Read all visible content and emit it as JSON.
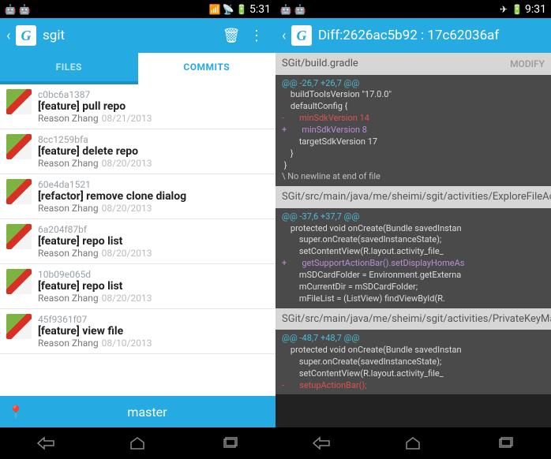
{
  "left": {
    "status": {
      "time": "5:31"
    },
    "actionbar": {
      "title": "sgit"
    },
    "tabs": {
      "files": "FILES",
      "commits": "COMMITS"
    },
    "commits": [
      {
        "hash": "c0bc6a1387",
        "msg": "[feature] pull repo",
        "author": "Reason Zhang",
        "date": "08/21/2013"
      },
      {
        "hash": "8cc1259bfa",
        "msg": "[feature] delete repo",
        "author": "Reason Zhang",
        "date": "08/20/2013"
      },
      {
        "hash": "60e4da1521",
        "msg": "[refactor] remove clone dialog",
        "author": "Reason Zhang",
        "date": "08/20/2013"
      },
      {
        "hash": "6a204f87bf",
        "msg": "[feature] repo list",
        "author": "Reason Zhang",
        "date": "08/20/2013"
      },
      {
        "hash": "10b09e065d",
        "msg": "[feature] repo list",
        "author": "Reason Zhang",
        "date": "08/20/2013"
      },
      {
        "hash": "45f9361f07",
        "msg": "[feature] view file",
        "author": "Reason Zhang",
        "date": "08/10/2013"
      }
    ],
    "bottom": {
      "branch": "master"
    }
  },
  "right": {
    "status": {
      "time": "9:31"
    },
    "actionbar": {
      "title": "Diff:2626ac5b92 : 17c62036af"
    },
    "files": [
      {
        "path": "SGit/build.gradle",
        "badge": "MODIFY",
        "hunk": "@@ -26,7 +26,7 @@",
        "lines": [
          {
            "cls": "ctx",
            "t": "    buildToolsVersion \"17.0.0\""
          },
          {
            "cls": "ctx",
            "t": ""
          },
          {
            "cls": "ctx",
            "t": "    defaultConfig {"
          },
          {
            "cls": "del",
            "t": "-       minSdkVersion 14"
          },
          {
            "cls": "add",
            "t": "+       minSdkVersion 8"
          },
          {
            "cls": "ctx",
            "t": "        targetSdkVersion 17"
          },
          {
            "cls": "ctx",
            "t": "    }"
          },
          {
            "cls": "ctx",
            "t": " }"
          },
          {
            "cls": "comment",
            "t": "\\ No newline at end of file"
          }
        ]
      },
      {
        "path": "SGit/src/main/java/me/sheimi/sgit/activities/ExploreFileActivity.java",
        "badge": "MODIFY",
        "hunk": "@@ -37,6 +37,7 @@",
        "lines": [
          {
            "cls": "ctx",
            "t": "    protected void onCreate(Bundle savedInstan"
          },
          {
            "cls": "ctx",
            "t": "        super.onCreate(savedInstanceState);"
          },
          {
            "cls": "ctx",
            "t": "        setContentView(R.layout.activity_file_"
          },
          {
            "cls": "add",
            "t": "+       getSupportActionBar().setDisplayHomeAs"
          },
          {
            "cls": "ctx",
            "t": "        mSDCardFolder = Environment.getExterna"
          },
          {
            "cls": "ctx",
            "t": "        mCurrentDir = mSDCardFolder;"
          },
          {
            "cls": "ctx",
            "t": "        mFileList = (ListView) findViewById(R."
          }
        ]
      },
      {
        "path": "SGit/src/main/java/me/sheimi/sgit/activities/PrivateKeyManageActivity.java",
        "badge": "MODIFY",
        "hunk": "@@ -48,7 +48,7 @@",
        "lines": [
          {
            "cls": "ctx",
            "t": "    protected void onCreate(Bundle savedInstan"
          },
          {
            "cls": "ctx",
            "t": "        super.onCreate(savedInstanceState);"
          },
          {
            "cls": "ctx",
            "t": "        setContentView(R.layout.activity_file_"
          },
          {
            "cls": "del",
            "t": "-       setupActionBar();"
          }
        ]
      }
    ]
  }
}
